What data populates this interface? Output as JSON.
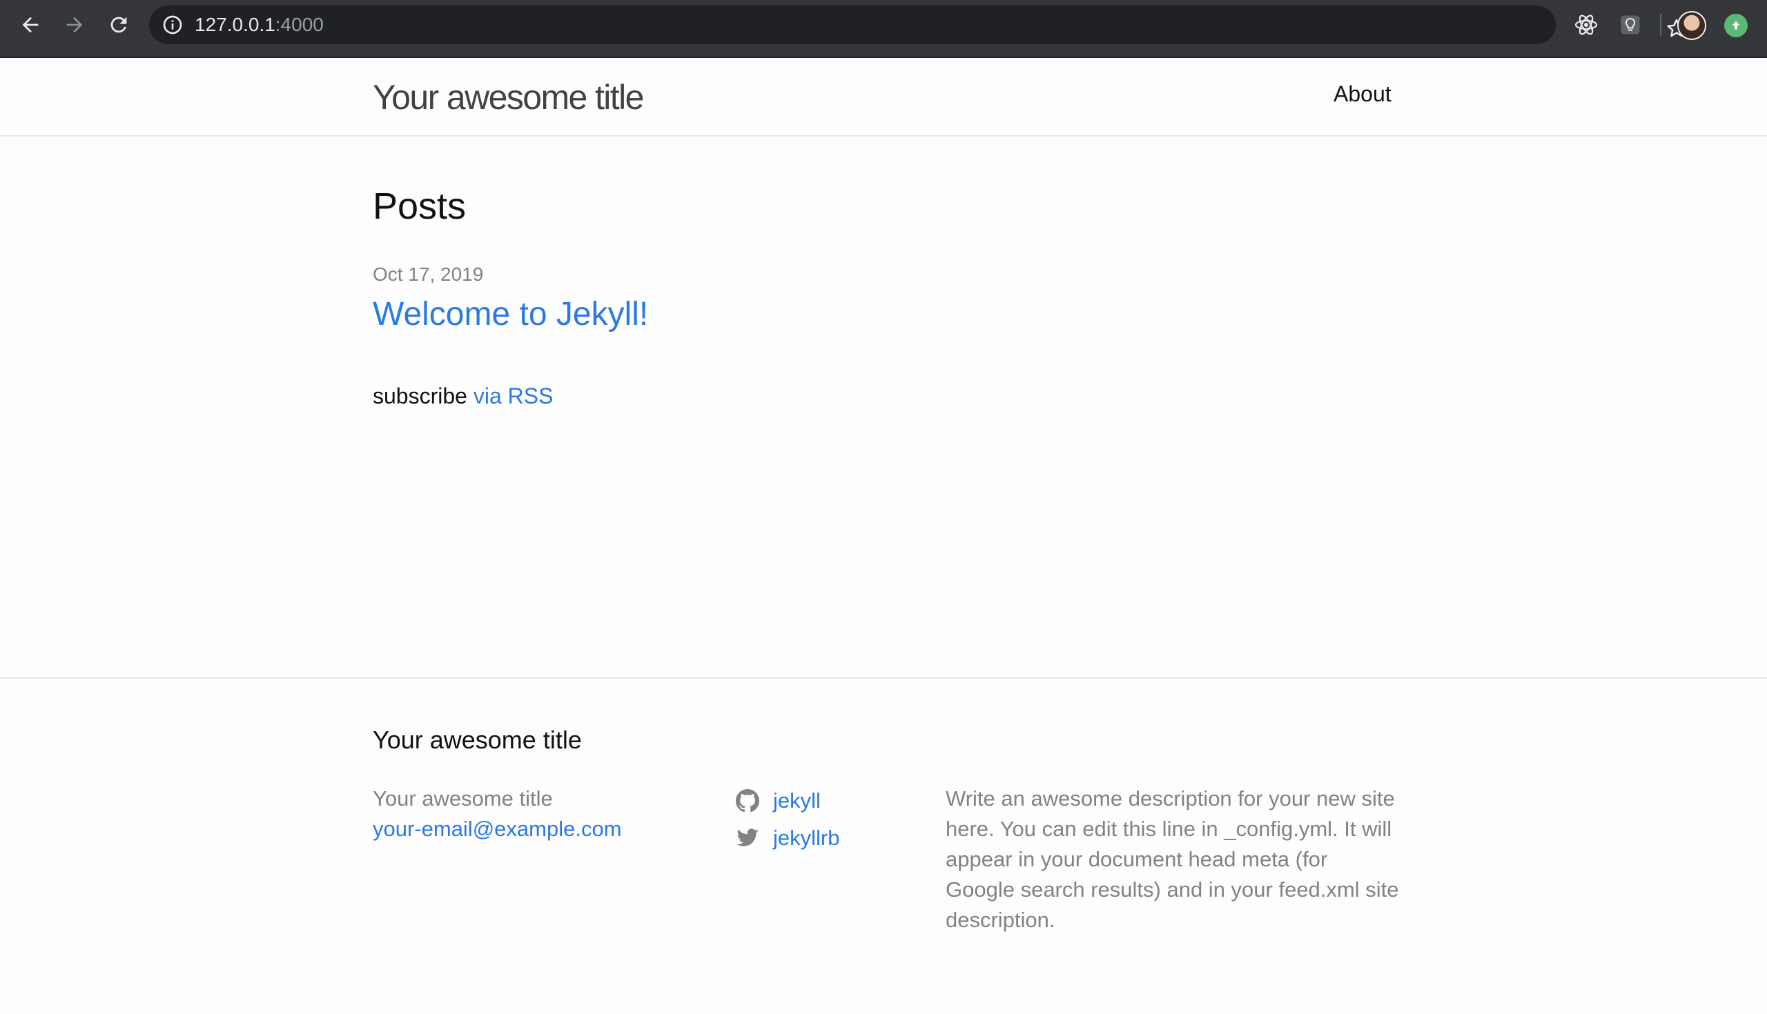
{
  "browser": {
    "url_host": "127.0.0.1",
    "url_port": ":4000",
    "icons": [
      "back-icon",
      "forward-icon",
      "reload-icon",
      "info-icon",
      "star-icon",
      "react-devtools-icon",
      "lightbulb-extension-icon",
      "profile-avatar",
      "update-icon"
    ]
  },
  "header": {
    "site_title": "Your awesome title",
    "nav": [
      {
        "label": "About"
      }
    ]
  },
  "main": {
    "heading": "Posts",
    "posts": [
      {
        "date": "Oct 17, 2019",
        "title": "Welcome to Jekyll!"
      }
    ],
    "subscribe_text": "subscribe",
    "subscribe_link": "via RSS"
  },
  "footer": {
    "heading": "Your awesome title",
    "name": "Your awesome title",
    "email": "your-email@example.com",
    "social": [
      {
        "icon": "github-icon",
        "label": "jekyll"
      },
      {
        "icon": "twitter-icon",
        "label": "jekyllrb"
      }
    ],
    "description": "Write an awesome description for your new site here. You can edit this line in _config.yml. It will appear in your document head meta (for Google search results) and in your feed.xml site description."
  },
  "colors": {
    "link": "#2a7ae2",
    "muted": "#828282",
    "chrome_bg": "#35363a",
    "omnibox_bg": "#202124"
  }
}
